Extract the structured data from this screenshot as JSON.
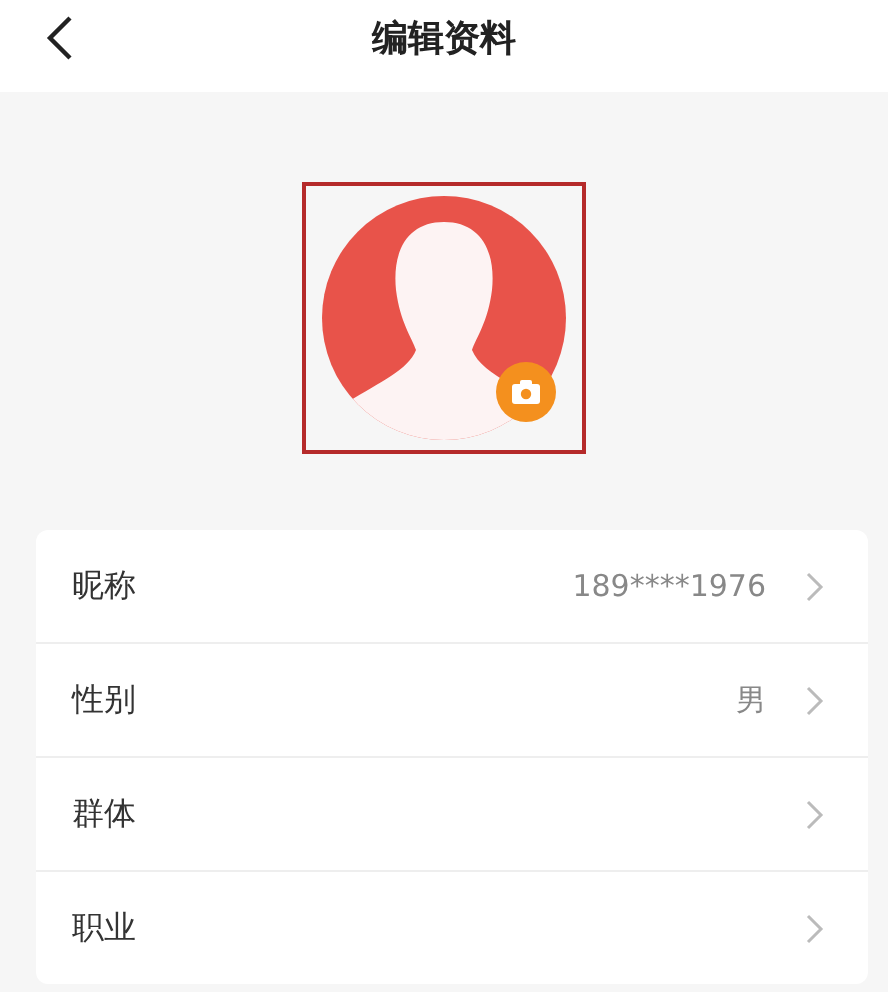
{
  "header": {
    "title": "编辑资料"
  },
  "avatar": {
    "selected": true
  },
  "fields": [
    {
      "label": "昵称",
      "value": "189****1976"
    },
    {
      "label": "性别",
      "value": "男"
    },
    {
      "label": "群体"
    },
    {
      "label": "职业"
    }
  ]
}
